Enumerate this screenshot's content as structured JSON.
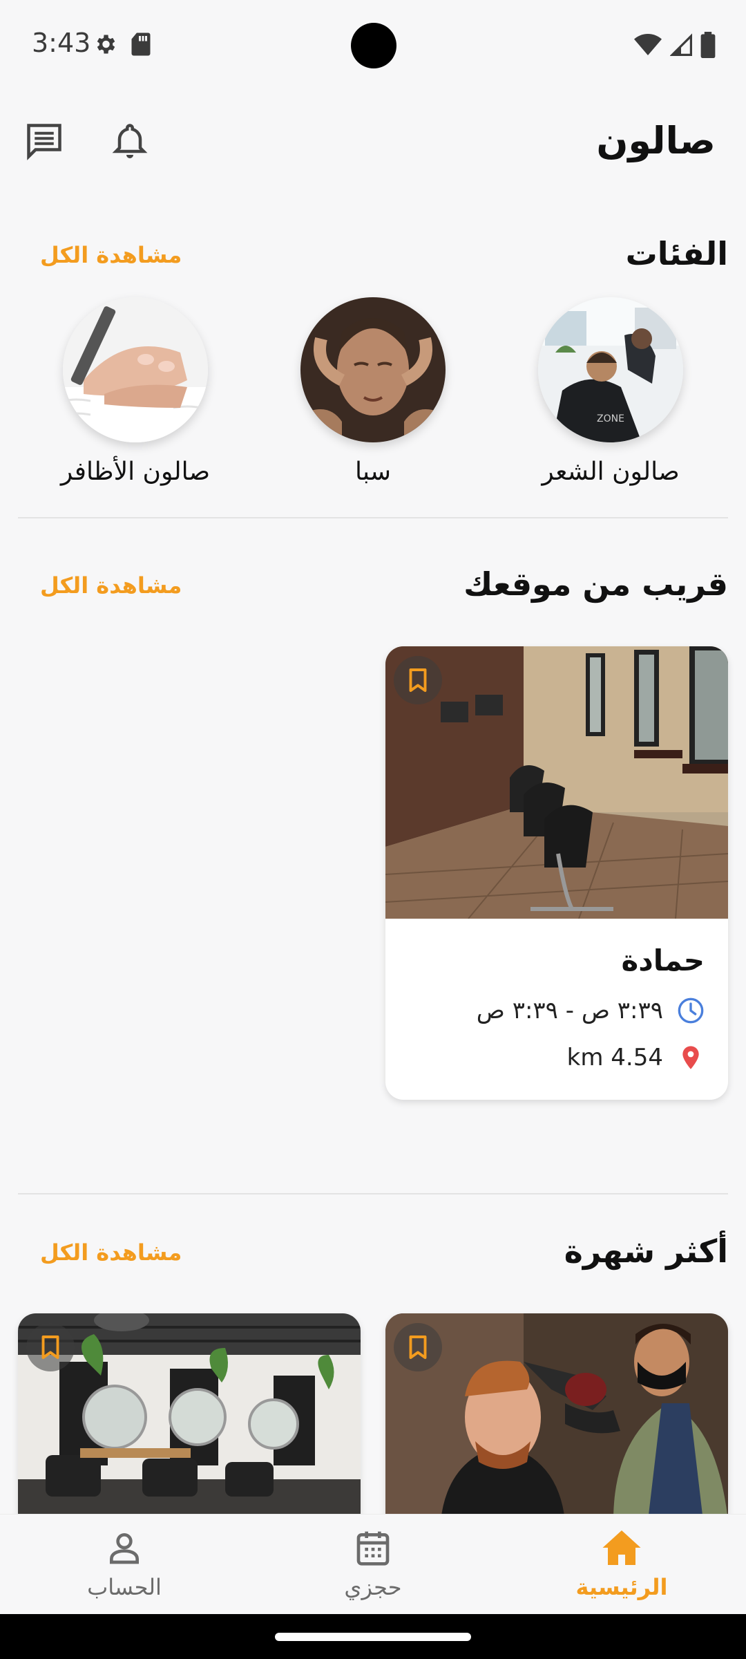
{
  "status": {
    "time": "3:43"
  },
  "header": {
    "title": "صالون"
  },
  "categories_section": {
    "title": "الفئات",
    "see_all": "مشاهدة الكل",
    "items": [
      {
        "label": "صالون الشعر",
        "image": "hair-salon-photo"
      },
      {
        "label": "سبا",
        "image": "spa-massage-photo"
      },
      {
        "label": "صالون الأظافر",
        "image": "nail-salon-photo"
      }
    ]
  },
  "nearby_section": {
    "title": "قريب من موقعك",
    "see_all": "مشاهدة الكل",
    "card": {
      "name": "حمادة",
      "hours": "٣:٣٩ ص - ٣:٣٩ ص",
      "distance": "km 4.54",
      "image": "salon-chairs-photo"
    }
  },
  "popular_section": {
    "title": "أكثر شهرة",
    "see_all": "مشاهدة الكل",
    "cards": [
      {
        "image": "barber-haircut-photo"
      },
      {
        "image": "salon-interior-photo"
      }
    ]
  },
  "bottom_nav": {
    "home": "الرئيسية",
    "bookings": "حجزي",
    "account": "الحساب"
  },
  "colors": {
    "accent": "#f39c1f",
    "clock_icon": "#4a7fdc",
    "pin_icon": "#e84c4c"
  }
}
